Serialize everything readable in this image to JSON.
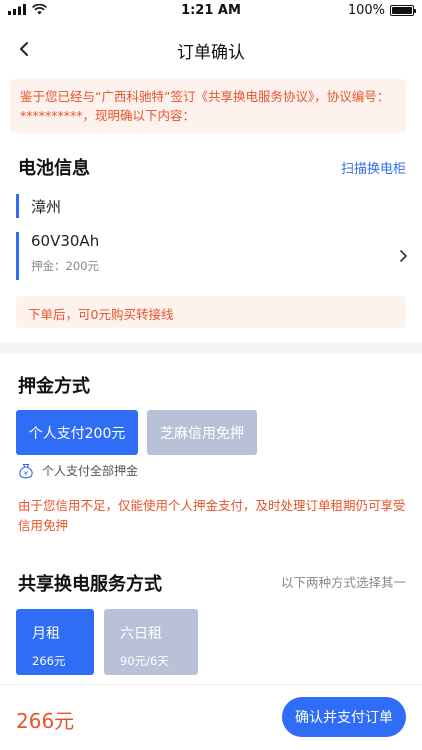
{
  "status_bar": {
    "time": "1:21 AM",
    "battery": "100%"
  },
  "nav": {
    "title": "订单确认"
  },
  "notice": {
    "text": "鉴于您已经与“广西科驰特”签订《共享换电服务协议》，协议编号：**********，现明确以下内容："
  },
  "battery_info": {
    "title": "电池信息",
    "scan_link": "扫描换电柜",
    "city": "漳州",
    "model": "60V30Ah",
    "deposit_label": "押金：",
    "deposit_value": "200元",
    "tip": "下单后，可0元购买转接线"
  },
  "deposit_method": {
    "title": "押金方式",
    "options": [
      "个人支付200元",
      "芝麻信用免押"
    ],
    "selected": "个人支付200元",
    "note": "个人支付全部押金",
    "warning": "由于您信用不足，仅能使用个人押金支付，及时处理订单租期仍可享受信用免押"
  },
  "service_method": {
    "title": "共享换电服务方式",
    "hint": "以下两种方式选择其一",
    "plans": [
      {
        "name": "月租",
        "price": "266元"
      },
      {
        "name": "六日租",
        "price": "90元/6天"
      }
    ]
  },
  "bottom": {
    "total": "266元",
    "confirm_label": "确认并支付订单"
  },
  "colors": {
    "accent": "#2f6df6",
    "warning": "#e8542a",
    "disabled": "#b9c1d9"
  }
}
